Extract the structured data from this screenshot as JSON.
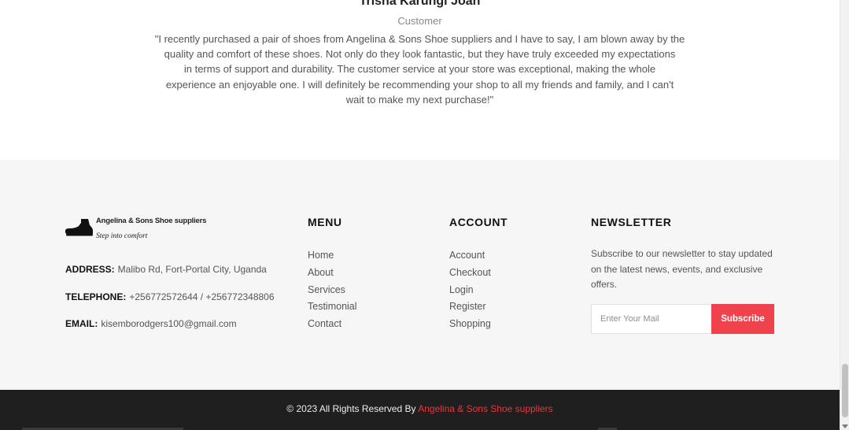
{
  "testimonial": {
    "name": "Trisha Karungi Joan",
    "role": "Customer",
    "quote_lines": [
      "\"I recently purchased a pair of shoes from Angelina & Sons Shoe suppliers and I have to say, I am blown away by the",
      "quality and comfort of these shoes. Not only do they look fantastic, but they have truly exceeded my expectations",
      "in terms of support and durability. The customer service at your store was exceptional, making the whole",
      "experience an enjoyable one. I will definitely be recommending your shop to all my friends and family, and I can't",
      "wait to make my next purchase!\""
    ]
  },
  "footer": {
    "brand": {
      "name": "Angelina & Sons Shoe suppliers",
      "tagline": "Step into comfort",
      "icon": "shoe-logo-icon"
    },
    "contact": {
      "address_label": "ADDRESS:",
      "address": "Malibo Rd, Fort-Portal City, Uganda",
      "telephone_label": "TELEPHONE:",
      "telephone": "+256772572644 / +256772348806",
      "email_label": "EMAIL:",
      "email": "kisemborodgers100@gmail.com"
    },
    "menu": {
      "heading": "MENU",
      "items": [
        "Home",
        "About",
        "Services",
        "Testimonial",
        "Contact"
      ]
    },
    "account": {
      "heading": "ACCOUNT",
      "items": [
        "Account",
        "Checkout",
        "Login",
        "Register",
        "Shopping"
      ]
    },
    "newsletter": {
      "heading": "NEWSLETTER",
      "description": "Subscribe to our newsletter to stay updated on the latest news, events, and exclusive offers.",
      "input_placeholder": "Enter Your Mail",
      "input_value": "",
      "button_label": "Subscribe"
    }
  },
  "copyright": {
    "prefix": "© 2023 All Rights Reserved By",
    "brand": "Angelina & Sons Shoe suppliers"
  },
  "colors": {
    "accent": "#f0424d",
    "copyright_link": "#e8373d",
    "footer_bg": "#f6f6f6",
    "copyright_bg": "#1f1f1f"
  }
}
